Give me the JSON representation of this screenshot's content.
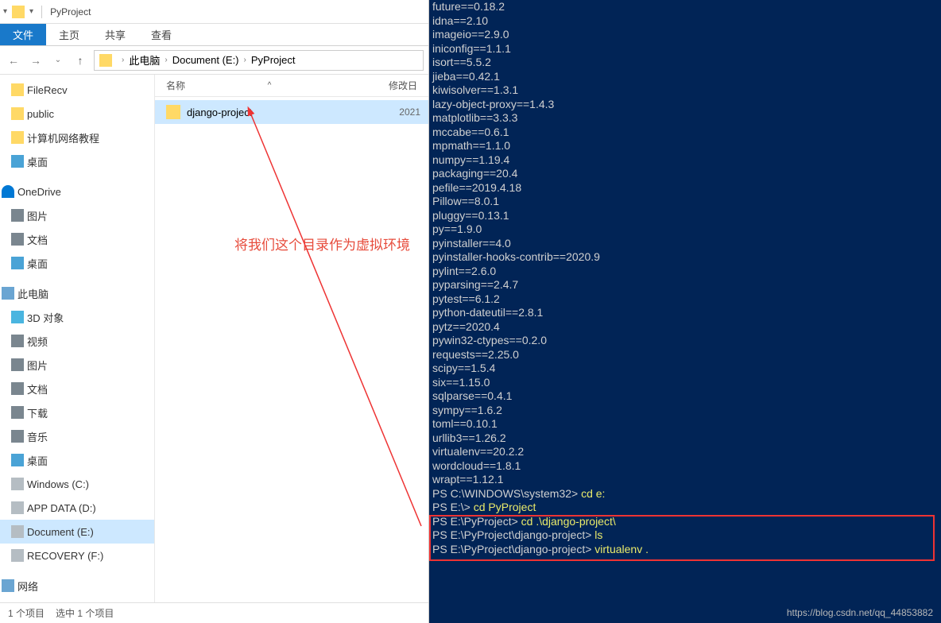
{
  "window": {
    "title": "PyProject"
  },
  "ribbon": {
    "file": "文件",
    "tabs": [
      "主页",
      "共享",
      "查看"
    ]
  },
  "breadcrumb": {
    "items": [
      "此电脑",
      "Document (E:)",
      "PyProject"
    ]
  },
  "sidebar": {
    "quick": [
      {
        "label": "FileRecv",
        "icon": "ic-folder"
      },
      {
        "label": "public",
        "icon": "ic-folder"
      },
      {
        "label": "计算机网络教程",
        "icon": "ic-folder"
      },
      {
        "label": "桌面",
        "icon": "ic-desktop"
      }
    ],
    "onedrive": {
      "label": "OneDrive",
      "icon": "ic-cloud"
    },
    "onedrive_items": [
      {
        "label": "图片",
        "icon": "ic-pic"
      },
      {
        "label": "文档",
        "icon": "ic-doc"
      },
      {
        "label": "桌面",
        "icon": "ic-desktop"
      }
    ],
    "thispc": {
      "label": "此电脑",
      "icon": "ic-pc"
    },
    "pc_items": [
      {
        "label": "3D 对象",
        "icon": "ic-3d"
      },
      {
        "label": "视频",
        "icon": "ic-video"
      },
      {
        "label": "图片",
        "icon": "ic-pic"
      },
      {
        "label": "文档",
        "icon": "ic-doc"
      },
      {
        "label": "下载",
        "icon": "ic-dl"
      },
      {
        "label": "音乐",
        "icon": "ic-music"
      },
      {
        "label": "桌面",
        "icon": "ic-desktop"
      },
      {
        "label": "Windows (C:)",
        "icon": "ic-drive"
      },
      {
        "label": "APP DATA (D:)",
        "icon": "ic-drive"
      },
      {
        "label": "Document (E:)",
        "icon": "ic-drive",
        "selected": true
      },
      {
        "label": "RECOVERY (F:)",
        "icon": "ic-drive"
      }
    ],
    "network": {
      "label": "网络",
      "icon": "ic-net"
    }
  },
  "columns": {
    "name": "名称",
    "sort": "^",
    "date": "修改日"
  },
  "files": [
    {
      "name": "django-project",
      "date": "2021",
      "selected": true
    }
  ],
  "annotation": "将我们这个目录作为虚拟环境",
  "status": {
    "count": "1 个项目",
    "selected": "选中 1 个项目"
  },
  "terminal": {
    "pip": [
      "future==0.18.2",
      "idna==2.10",
      "imageio==2.9.0",
      "iniconfig==1.1.1",
      "isort==5.5.2",
      "jieba==0.42.1",
      "kiwisolver==1.3.1",
      "lazy-object-proxy==1.4.3",
      "matplotlib==3.3.3",
      "mccabe==0.6.1",
      "mpmath==1.1.0",
      "numpy==1.19.4",
      "packaging==20.4",
      "pefile==2019.4.18",
      "Pillow==8.0.1",
      "pluggy==0.13.1",
      "py==1.9.0",
      "pyinstaller==4.0",
      "pyinstaller-hooks-contrib==2020.9",
      "pylint==2.6.0",
      "pyparsing==2.4.7",
      "pytest==6.1.2",
      "python-dateutil==2.8.1",
      "pytz==2020.4",
      "pywin32-ctypes==0.2.0",
      "requests==2.25.0",
      "scipy==1.5.4",
      "six==1.15.0",
      "sqlparse==0.4.1",
      "sympy==1.6.2",
      "toml==0.10.1",
      "urllib3==1.26.2",
      "virtualenv==20.2.2",
      "wordcloud==1.8.1",
      "wrapt==1.12.1"
    ],
    "commands": [
      {
        "prompt": "PS C:\\WINDOWS\\system32> ",
        "cmd": "cd e:"
      },
      {
        "prompt": "PS E:\\> ",
        "cmd": "cd PyProject"
      },
      {
        "prompt": "PS E:\\PyProject> ",
        "cmd": "cd .\\django-project\\"
      },
      {
        "prompt": "PS E:\\PyProject\\django-project> ",
        "cmd": "ls"
      },
      {
        "prompt": "PS E:\\PyProject\\django-project> ",
        "cmd": "virtualenv ."
      }
    ]
  },
  "watermark": "https://blog.csdn.net/qq_44853882"
}
